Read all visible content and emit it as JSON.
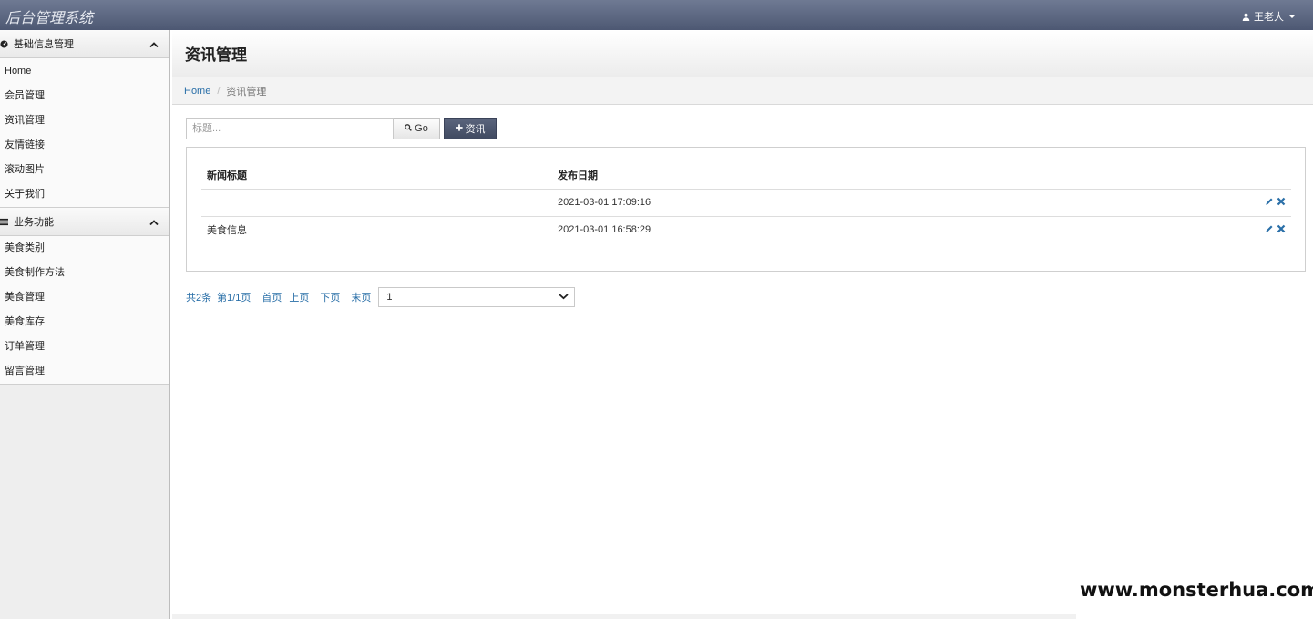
{
  "app": {
    "title": "后台管理系统"
  },
  "user": {
    "name": "王老大"
  },
  "sidebar": {
    "groups": [
      {
        "label": "基础信息管理",
        "items": [
          "Home",
          "会员管理",
          "资讯管理",
          "友情链接",
          "滚动图片",
          "关于我们"
        ]
      },
      {
        "label": "业务功能",
        "items": [
          "美食类别",
          "美食制作方法",
          "美食管理",
          "美食库存",
          "订单管理",
          "留言管理"
        ]
      }
    ]
  },
  "page": {
    "title": "资讯管理",
    "breadcrumb": {
      "home": "Home",
      "current": "资讯管理"
    }
  },
  "toolbar": {
    "search_placeholder": "标题...",
    "go_label": "Go",
    "add_label": "资讯"
  },
  "table": {
    "headers": [
      "新闻标题",
      "发布日期"
    ],
    "rows": [
      {
        "title": "",
        "date": "2021-03-01 17:09:16"
      },
      {
        "title": "美食信息",
        "date": "2021-03-01 16:58:29"
      }
    ]
  },
  "pager": {
    "total": "共2条",
    "page_info": "第1/1页",
    "first": "首页",
    "prev": "上页",
    "next": "下页",
    "last": "末页",
    "selected": "1"
  },
  "watermark": "www.monsterhua.com",
  "colors": {
    "accent": "#2a6fa8",
    "topbar": "#5a6580",
    "action_icon": "#2a6fa8"
  }
}
